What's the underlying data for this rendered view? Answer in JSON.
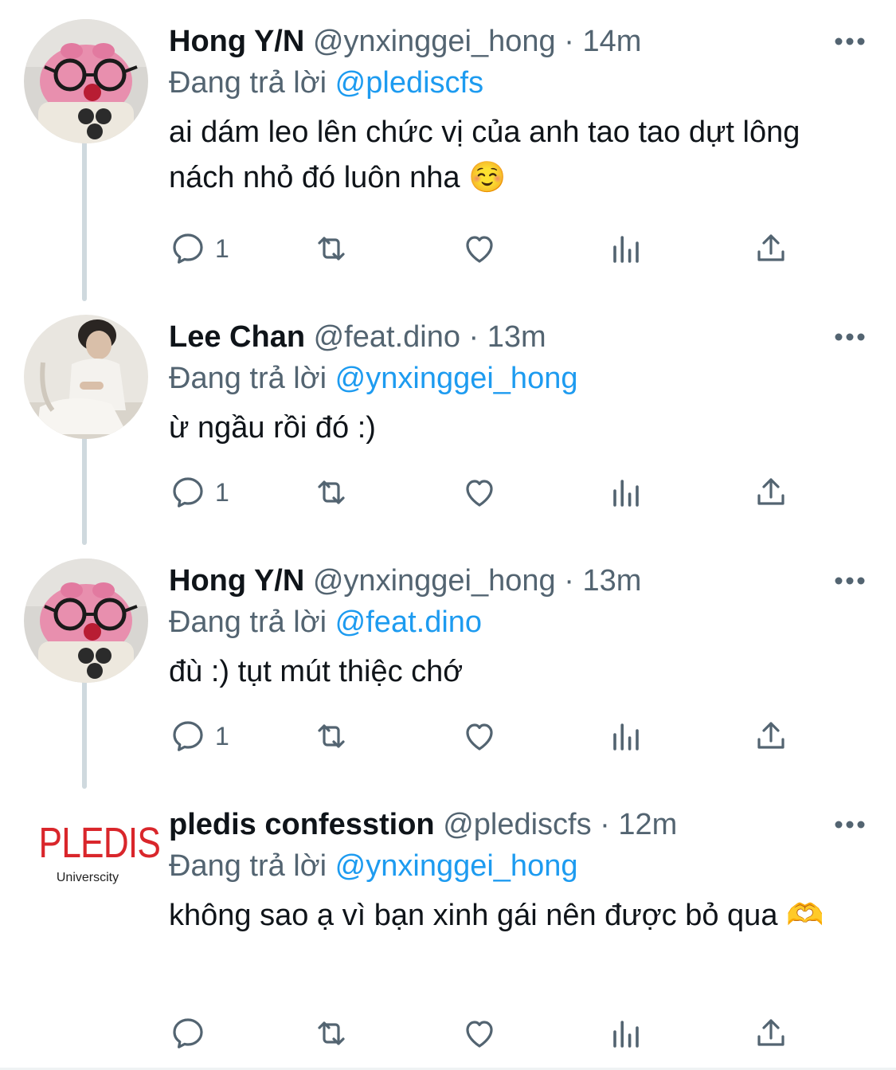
{
  "tweets": [
    {
      "name": "Hong Y/N",
      "handle": "@ynxinggei_hong",
      "dot": "·",
      "time": "14m",
      "replying_prefix": "Đang trả lời ",
      "replying_to": "@plediscfs",
      "text": "ai dám leo lên chức vị của anh tao tao dựt lông nách nhỏ đó luôn nha ☺️",
      "reply_count": "1",
      "avatar": "pink-plush-avatar"
    },
    {
      "name": "Lee Chan",
      "handle": "@feat.dino",
      "dot": "·",
      "time": "13m",
      "replying_prefix": "Đang trả lời ",
      "replying_to": "@ynxinggei_hong",
      "text": "ừ ngầu rồi đó :)",
      "reply_count": "1",
      "avatar": "person-photo-avatar"
    },
    {
      "name": "Hong Y/N",
      "handle": "@ynxinggei_hong",
      "dot": "·",
      "time": "13m",
      "replying_prefix": "Đang trả lời ",
      "replying_to": "@feat.dino",
      "text": "đù :) tụt mút thiệc chớ",
      "reply_count": "1",
      "avatar": "pink-plush-avatar"
    },
    {
      "name": "pledis confesstion",
      "handle": "@plediscfs",
      "dot": "·",
      "time": "12m",
      "replying_prefix": "Đang trả lời ",
      "replying_to": "@ynxinggei_hong",
      "text": "không sao ạ vì bạn xinh gái nên được bỏ qua 🫶",
      "reply_count": "",
      "avatar": "pledis-logo-avatar",
      "logo_text": "PLEDIS",
      "logo_subtext": "Universcity"
    }
  ],
  "colors": {
    "link": "#1d9bf0",
    "secondary_text": "#536471",
    "thread_line": "#cfd9de",
    "logo_red": "#d9262b"
  },
  "icons": [
    "reply-icon",
    "retweet-icon",
    "like-icon",
    "views-icon",
    "share-icon",
    "more-icon"
  ]
}
